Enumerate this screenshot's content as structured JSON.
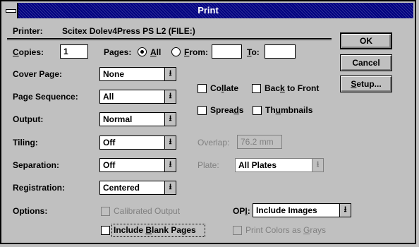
{
  "window": {
    "title": "Print"
  },
  "printer": {
    "label": "Printer:",
    "value": "Scitex Dolev4Press PS L2  (FILE:)"
  },
  "copies": {
    "label": "Copies:",
    "value": "1"
  },
  "pages": {
    "label": "Pages:",
    "all_label": "All",
    "from_label": "From:",
    "to_label": "To:",
    "from_value": "",
    "to_value": ""
  },
  "cover_page": {
    "label": "Cover Page:",
    "value": "None"
  },
  "page_sequence": {
    "label": "Page Sequence:",
    "value": "All"
  },
  "output": {
    "label": "Output:",
    "value": "Normal"
  },
  "tiling": {
    "label": "Tiling:",
    "value": "Off"
  },
  "separation": {
    "label": "Separation:",
    "value": "Off"
  },
  "registration": {
    "label": "Registration:",
    "value": "Centered"
  },
  "options": {
    "label": "Options:"
  },
  "checkboxes": {
    "collate": "Collate",
    "back_to_front": "Back to Front",
    "spreads": "Spreads",
    "thumbnails": "Thumbnails",
    "calibrated_output": "Calibrated Output",
    "include_blank_pages": "Include Blank Pages",
    "print_colors_as_grays": "Print Colors as Grays"
  },
  "overlap": {
    "label": "Overlap:",
    "value": "76.2 mm"
  },
  "plate": {
    "label": "Plate:",
    "value": "All Plates"
  },
  "opi": {
    "label": "OPI:",
    "value": "Include Images"
  },
  "buttons": {
    "ok": "OK",
    "cancel": "Cancel",
    "setup": "Setup..."
  },
  "icons": {
    "dropdown_arrow": "⭳",
    "system_menu": "system-menu-icon"
  }
}
